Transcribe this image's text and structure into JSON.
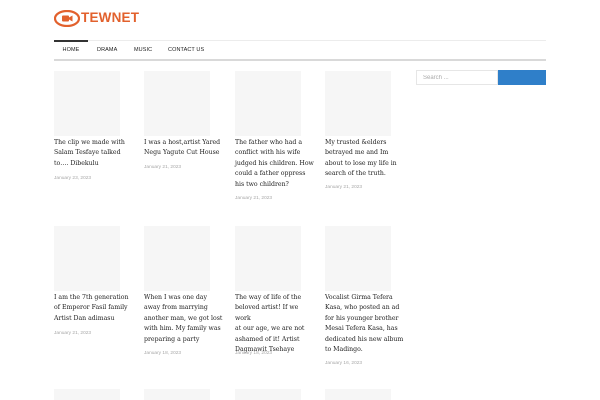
{
  "site": {
    "logo_text": "TEWNET",
    "brand_color": "#e2612d",
    "logo_icon": "camera-eye-icon"
  },
  "nav": {
    "items": [
      {
        "label": "HOME",
        "active": true
      },
      {
        "label": "DRAMA"
      },
      {
        "label": "MUSIC"
      },
      {
        "label": "CONTACT US"
      }
    ]
  },
  "sidebar": {
    "search_placeholder": "Search ...",
    "search_button_color": "#2f7fc9"
  },
  "posts": [
    {
      "title_lines": [
        "The clip we made with",
        "Salam Tesfaye talked",
        "to…. Dibekulu"
      ],
      "date": "January 23, 2023"
    },
    {
      "title_lines": [
        "I was a host,artist Yared",
        "Negu Yagute Cut House"
      ],
      "date": "January 21, 2023"
    },
    {
      "title_lines": [
        "The father who had a",
        "conflict with his wife",
        "judged his children. How",
        "could a father oppress",
        "his two children?"
      ],
      "date": "January 21, 2023"
    },
    {
      "title_lines": [
        "My trusted &elders",
        "betrayed me and Im",
        "about to lose my life in",
        "search of the truth."
      ],
      "date": "January 21, 2023"
    },
    {
      "title_lines": [
        "I am the 7th generation",
        "of Emperor Fasil family",
        "Artist Dan adimasu"
      ],
      "date": "January 21, 2023"
    },
    {
      "title_lines": [
        "When I was one day",
        "away from marrying",
        "another man, we got lost",
        "with him. My family was",
        "preparing a party"
      ],
      "date": "January 18, 2023"
    },
    {
      "title_lines": [
        "The way of life of the",
        "beloved artist! If we work",
        "at our age, we are not",
        "ashamed of it! Artist",
        "Dagmawit Tsehaye"
      ],
      "date": "January 18, 2023"
    },
    {
      "title_lines": [
        "Vocalist Girma Tefera",
        "Kasa, who posted an ad",
        "for his younger brother",
        "Mesai Tefera Kasa, has",
        "dedicated his new album",
        "to Madingo."
      ],
      "date": "January 16, 2023"
    }
  ]
}
